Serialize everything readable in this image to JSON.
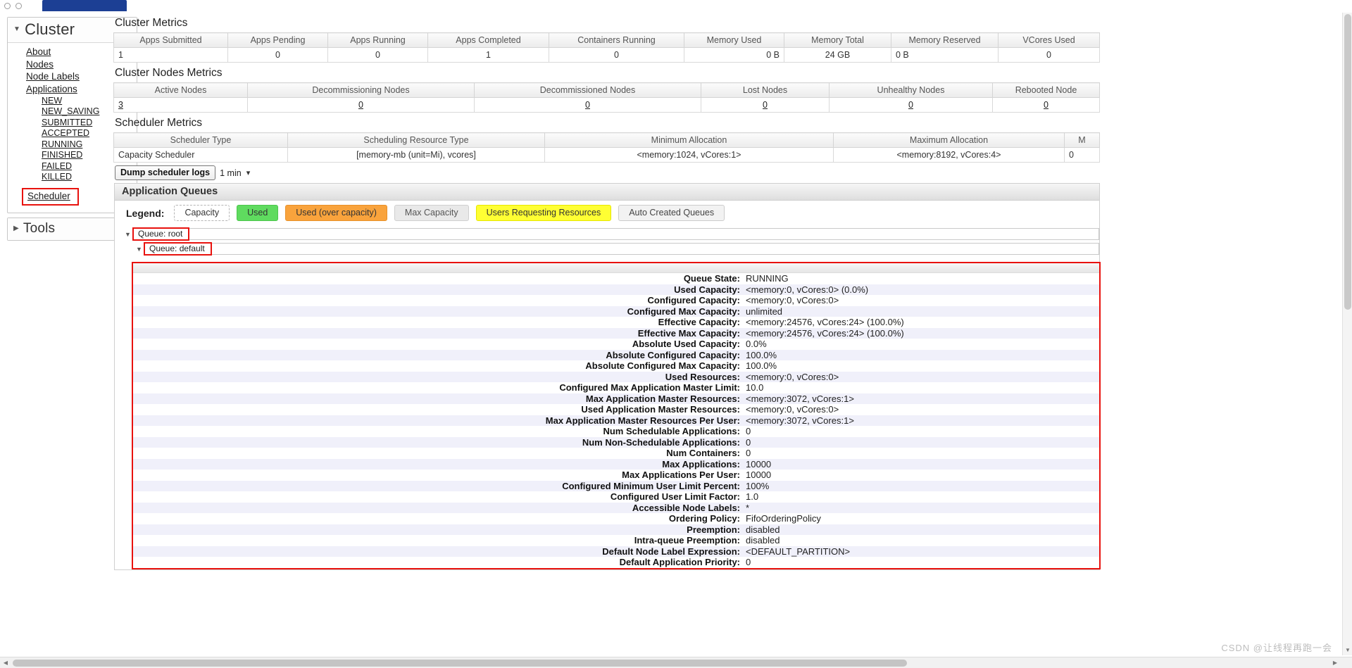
{
  "sidebar": {
    "cluster_title": "Cluster",
    "tools_title": "Tools",
    "items": [
      {
        "label": "About"
      },
      {
        "label": "Nodes"
      },
      {
        "label": "Node Labels"
      },
      {
        "label": "Applications"
      }
    ],
    "app_states": [
      {
        "label": "NEW"
      },
      {
        "label": "NEW_SAVING"
      },
      {
        "label": "SUBMITTED"
      },
      {
        "label": "ACCEPTED"
      },
      {
        "label": "RUNNING"
      },
      {
        "label": "FINISHED"
      },
      {
        "label": "FAILED"
      },
      {
        "label": "KILLED"
      }
    ],
    "scheduler_label": "Scheduler"
  },
  "cluster_metrics": {
    "title": "Cluster Metrics",
    "headers": [
      "Apps Submitted",
      "Apps Pending",
      "Apps Running",
      "Apps Completed",
      "Containers Running",
      "Memory Used",
      "Memory Total",
      "Memory Reserved",
      "VCores Used"
    ],
    "values": [
      "1",
      "0",
      "0",
      "1",
      "0",
      "0 B",
      "24 GB",
      "0 B",
      "0"
    ]
  },
  "cluster_nodes_metrics": {
    "title": "Cluster Nodes Metrics",
    "headers": [
      "Active Nodes",
      "Decommissioning Nodes",
      "Decommissioned Nodes",
      "Lost Nodes",
      "Unhealthy Nodes",
      "Rebooted Node"
    ],
    "values": [
      "3",
      "0",
      "0",
      "0",
      "0",
      "0"
    ]
  },
  "scheduler_metrics": {
    "title": "Scheduler Metrics",
    "headers": [
      "Scheduler Type",
      "Scheduling Resource Type",
      "Minimum Allocation",
      "Maximum Allocation",
      "M"
    ],
    "values": [
      "Capacity Scheduler",
      "[memory-mb (unit=Mi), vcores]",
      "<memory:1024, vCores:1>",
      "<memory:8192, vCores:4>",
      "0"
    ]
  },
  "dump_logs": {
    "button_label": "Dump scheduler logs",
    "selected_period": "1 min"
  },
  "application_queues": {
    "title": "Application Queues",
    "legend_label": "Legend:",
    "legend": [
      {
        "label": "Capacity",
        "color": "#ffffff"
      },
      {
        "label": "Used",
        "color": "#5fdb5f"
      },
      {
        "label": "Used (over capacity)",
        "color": "#f9a33c"
      },
      {
        "label": "Max Capacity",
        "color": "#e9e9e9"
      },
      {
        "label": "Users Requesting Resources",
        "color": "#ffff33"
      },
      {
        "label": "Auto Created Queues",
        "color": "#f2f2f2"
      }
    ],
    "queues": [
      {
        "label": "Queue: root",
        "level": 0
      },
      {
        "label": "Queue: default",
        "level": 1
      }
    ]
  },
  "queue_detail": {
    "rows": [
      {
        "key": "Queue State:",
        "value": "RUNNING"
      },
      {
        "key": "Used Capacity:",
        "value": "<memory:0, vCores:0> (0.0%)"
      },
      {
        "key": "Configured Capacity:",
        "value": "<memory:0, vCores:0>"
      },
      {
        "key": "Configured Max Capacity:",
        "value": "unlimited"
      },
      {
        "key": "Effective Capacity:",
        "value": "<memory:24576, vCores:24> (100.0%)"
      },
      {
        "key": "Effective Max Capacity:",
        "value": "<memory:24576, vCores:24> (100.0%)"
      },
      {
        "key": "Absolute Used Capacity:",
        "value": "0.0%"
      },
      {
        "key": "Absolute Configured Capacity:",
        "value": "100.0%"
      },
      {
        "key": "Absolute Configured Max Capacity:",
        "value": "100.0%"
      },
      {
        "key": "Used Resources:",
        "value": "<memory:0, vCores:0>"
      },
      {
        "key": "Configured Max Application Master Limit:",
        "value": "10.0"
      },
      {
        "key": "Max Application Master Resources:",
        "value": "<memory:3072, vCores:1>"
      },
      {
        "key": "Used Application Master Resources:",
        "value": "<memory:0, vCores:0>"
      },
      {
        "key": "Max Application Master Resources Per User:",
        "value": "<memory:3072, vCores:1>"
      },
      {
        "key": "Num Schedulable Applications:",
        "value": "0"
      },
      {
        "key": "Num Non-Schedulable Applications:",
        "value": "0"
      },
      {
        "key": "Num Containers:",
        "value": "0"
      },
      {
        "key": "Max Applications:",
        "value": "10000"
      },
      {
        "key": "Max Applications Per User:",
        "value": "10000"
      },
      {
        "key": "Configured Minimum User Limit Percent:",
        "value": "100%"
      },
      {
        "key": "Configured User Limit Factor:",
        "value": "1.0"
      },
      {
        "key": "Accessible Node Labels:",
        "value": "*"
      },
      {
        "key": "Ordering Policy:",
        "value": "FifoOrderingPolicy"
      },
      {
        "key": "Preemption:",
        "value": "disabled"
      },
      {
        "key": "Intra-queue Preemption:",
        "value": "disabled"
      },
      {
        "key": "Default Node Label Expression:",
        "value": "<DEFAULT_PARTITION>"
      },
      {
        "key": "Default Application Priority:",
        "value": "0"
      }
    ]
  },
  "watermark": {
    "text": "CSDN @让线程再跑一会"
  }
}
